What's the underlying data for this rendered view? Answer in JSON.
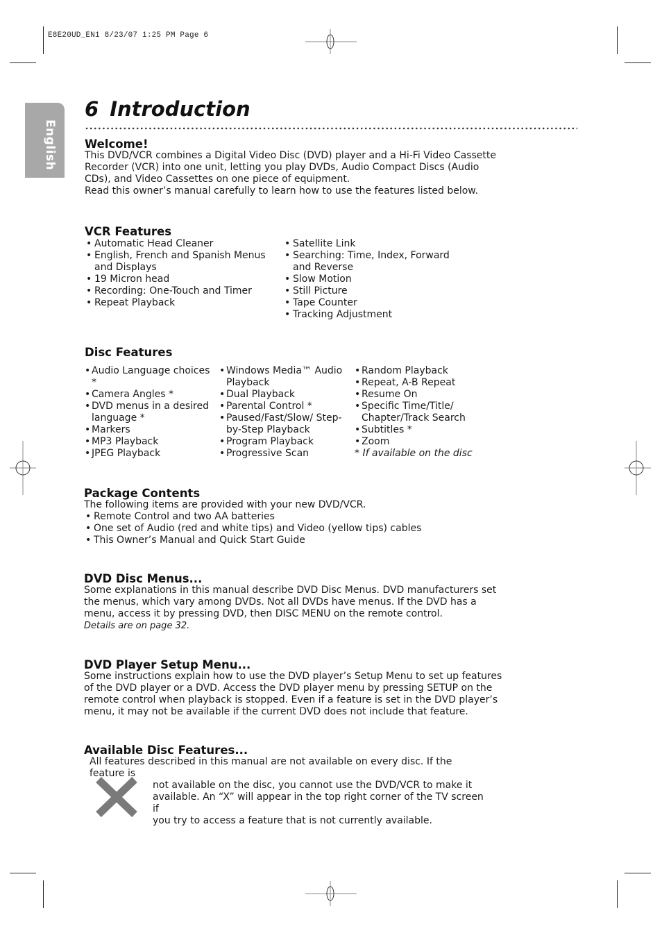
{
  "slug": "E8E20UD_EN1  8/23/07  1:25 PM  Page 6",
  "language_tab": "English",
  "page_number": "6",
  "page_title": "Introduction",
  "welcome": {
    "heading": "Welcome!",
    "lines": [
      "This DVD/VCR combines a Digital Video Disc (DVD) player and a Hi-Fi Video Cassette",
      "Recorder (VCR) into one unit, letting you play DVDs, Audio Compact Discs (Audio",
      "CDs), and Video Cassettes on one piece of equipment.",
      "Read this owner’s manual carefully to learn how to use the features listed below."
    ]
  },
  "vcr_features": {
    "heading": "VCR Features",
    "left": [
      "Automatic Head Cleaner",
      "English, French and Spanish Menus and Displays",
      "19 Micron head",
      "Recording: One-Touch and Timer",
      "Repeat Playback"
    ],
    "right": [
      "Satellite Link",
      "Searching: Time, Index, Forward and Reverse",
      "Slow Motion",
      "Still Picture",
      "Tape Counter",
      "Tracking Adjustment"
    ]
  },
  "disc_features": {
    "heading": "Disc Features",
    "col1": [
      "Audio Language choices *",
      "Camera Angles *",
      "DVD menus in a desired language *",
      "Markers",
      "MP3 Playback",
      "JPEG Playback"
    ],
    "col2": [
      "Windows Media™ Audio Playback",
      "Dual Playback",
      "Parental Control *",
      "Paused/Fast/Slow/ Step-by-Step Playback",
      "Program Playback",
      "Progressive Scan"
    ],
    "col3": [
      "Random Playback",
      "Repeat, A-B Repeat",
      "Resume On",
      "Specific Time/Title/ Chapter/Track Search",
      "Subtitles *",
      "Zoom"
    ],
    "footnote": "* If available on the disc"
  },
  "package_contents": {
    "heading": "Package Contents",
    "intro": "The following items are provided with your new DVD/VCR.",
    "items": [
      "Remote Control and two AA batteries",
      "One set of Audio (red and white tips) and Video (yellow tips) cables",
      "This Owner’s Manual and Quick Start Guide"
    ]
  },
  "dvd_disc_menus": {
    "heading": "DVD Disc Menus...",
    "lines": [
      "Some explanations in this manual describe DVD Disc Menus. DVD manufacturers set",
      "the menus, which vary among DVDs. Not all DVDs have menus. If the DVD has a",
      "menu, access it by pressing DVD, then DISC MENU on the remote control."
    ],
    "note": "Details are on page 32."
  },
  "dvd_setup_menu": {
    "heading": "DVD Player Setup Menu...",
    "lines": [
      "Some instructions explain how to use the DVD player’s Setup Menu to set up features",
      "of the DVD player or a DVD. Access the DVD player menu by pressing SETUP on the",
      "remote control when playback is stopped. Even if a feature is set in the DVD player’s",
      "menu, it may not be available if the current DVD does not include that feature."
    ]
  },
  "available_disc_features": {
    "heading": "Available Disc Features...",
    "first_line": "All features described in this manual are not available on every disc. If the feature is",
    "lines": [
      "not available on the disc, you cannot use the DVD/VCR to make it",
      "available. An “X” will appear in the top right corner of the TV screen if",
      "you try to access a feature that is not currently available."
    ],
    "icon": "x-mark-icon"
  },
  "colors": {
    "tab_gray": "#a8a8a8",
    "x_icon_gray": "#7a7a7a",
    "text": "#1a1a1a"
  }
}
